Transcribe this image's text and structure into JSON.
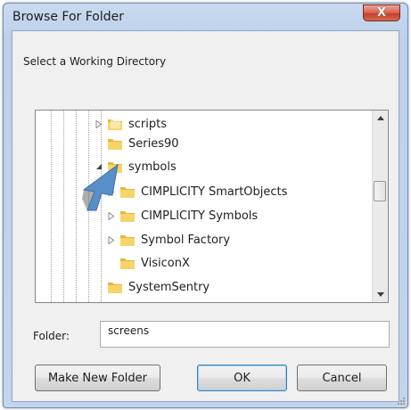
{
  "window": {
    "title": "Browse For Folder",
    "close_glyph": "X"
  },
  "prompt": "Select a Working Directory",
  "tree": {
    "items": [
      {
        "label": "scripts",
        "expander": "collapsed"
      },
      {
        "label": "Series90",
        "expander": "none"
      },
      {
        "label": "symbols",
        "expander": "expanded"
      },
      {
        "label": "CIMPLICITY SmartObjects",
        "expander": "collapsed"
      },
      {
        "label": "CIMPLICITY Symbols",
        "expander": "collapsed"
      },
      {
        "label": "Symbol Factory",
        "expander": "collapsed"
      },
      {
        "label": "VisiconX",
        "expander": "none"
      },
      {
        "label": "SystemSentry",
        "expander": "none"
      }
    ]
  },
  "folder": {
    "label": "Folder:",
    "value": "screens"
  },
  "buttons": {
    "make_new_folder": "Make New Folder",
    "ok": "OK",
    "cancel": "Cancel"
  },
  "colors": {
    "window_frame": "#c2d5ec",
    "close_button": "#d8604b",
    "folder_icon": "#f3c54a",
    "cursor_arrow": "#5b8fc9"
  },
  "icons": [
    "close-icon",
    "folder-icon",
    "expander-collapsed-icon",
    "expander-expanded-icon",
    "scroll-up-icon",
    "scroll-down-icon",
    "resize-grip-icon",
    "cursor-arrow-icon"
  ]
}
